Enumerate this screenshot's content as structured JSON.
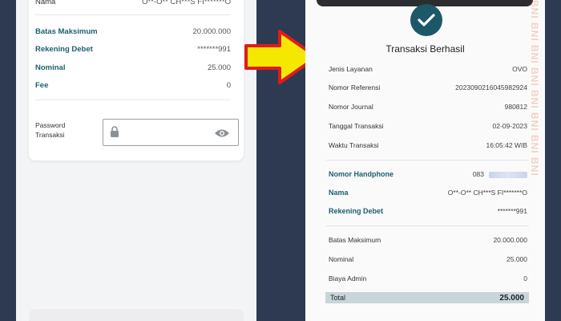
{
  "left": {
    "rows": [
      {
        "label": "Nama",
        "value": "O**-O** CH***S FI*******O"
      },
      {
        "label": "Batas Maksimum",
        "value": "20.000.000"
      },
      {
        "label": "Rekening Debet",
        "value": "*******991"
      },
      {
        "label": "Nominal",
        "value": "25.000"
      },
      {
        "label": "Fee",
        "value": "0"
      }
    ],
    "password_label_line1": "Password",
    "password_label_line2": "Transaksi",
    "password_value": ""
  },
  "right": {
    "title": "Transaksi Berhasil",
    "rows": [
      {
        "label": "Jenis Layanan",
        "value": "OVO"
      },
      {
        "label": "Nomor Referensi",
        "value": "2023090216045982924"
      },
      {
        "label": "Nomor Journal",
        "value": "980812"
      },
      {
        "label": "Tanggal Transaksi",
        "value": "02-09-2023"
      },
      {
        "label": "Waktu Transaksi",
        "value": "16:05:42 WIB"
      },
      {
        "label": "Nomor Handphone",
        "value": "083"
      },
      {
        "label": "Nama",
        "value": "O**-O** CH***S FI*******O"
      },
      {
        "label": "Rekening Debet",
        "value": "*******991"
      },
      {
        "label": "Batas Maksimum",
        "value": "20.000.000"
      },
      {
        "label": "Nominal",
        "value": "25.000"
      },
      {
        "label": "Biaya Admin",
        "value": "0"
      }
    ],
    "total_label": "Total",
    "total_value": "25.000"
  },
  "watermark": "BNI BNI BNI BNI BNI BNI BNI BNI",
  "colors": {
    "accent": "#1d5868",
    "background": "#2e3a52",
    "arrow_fill": "#f4e700",
    "arrow_stroke": "#e01b1b"
  }
}
